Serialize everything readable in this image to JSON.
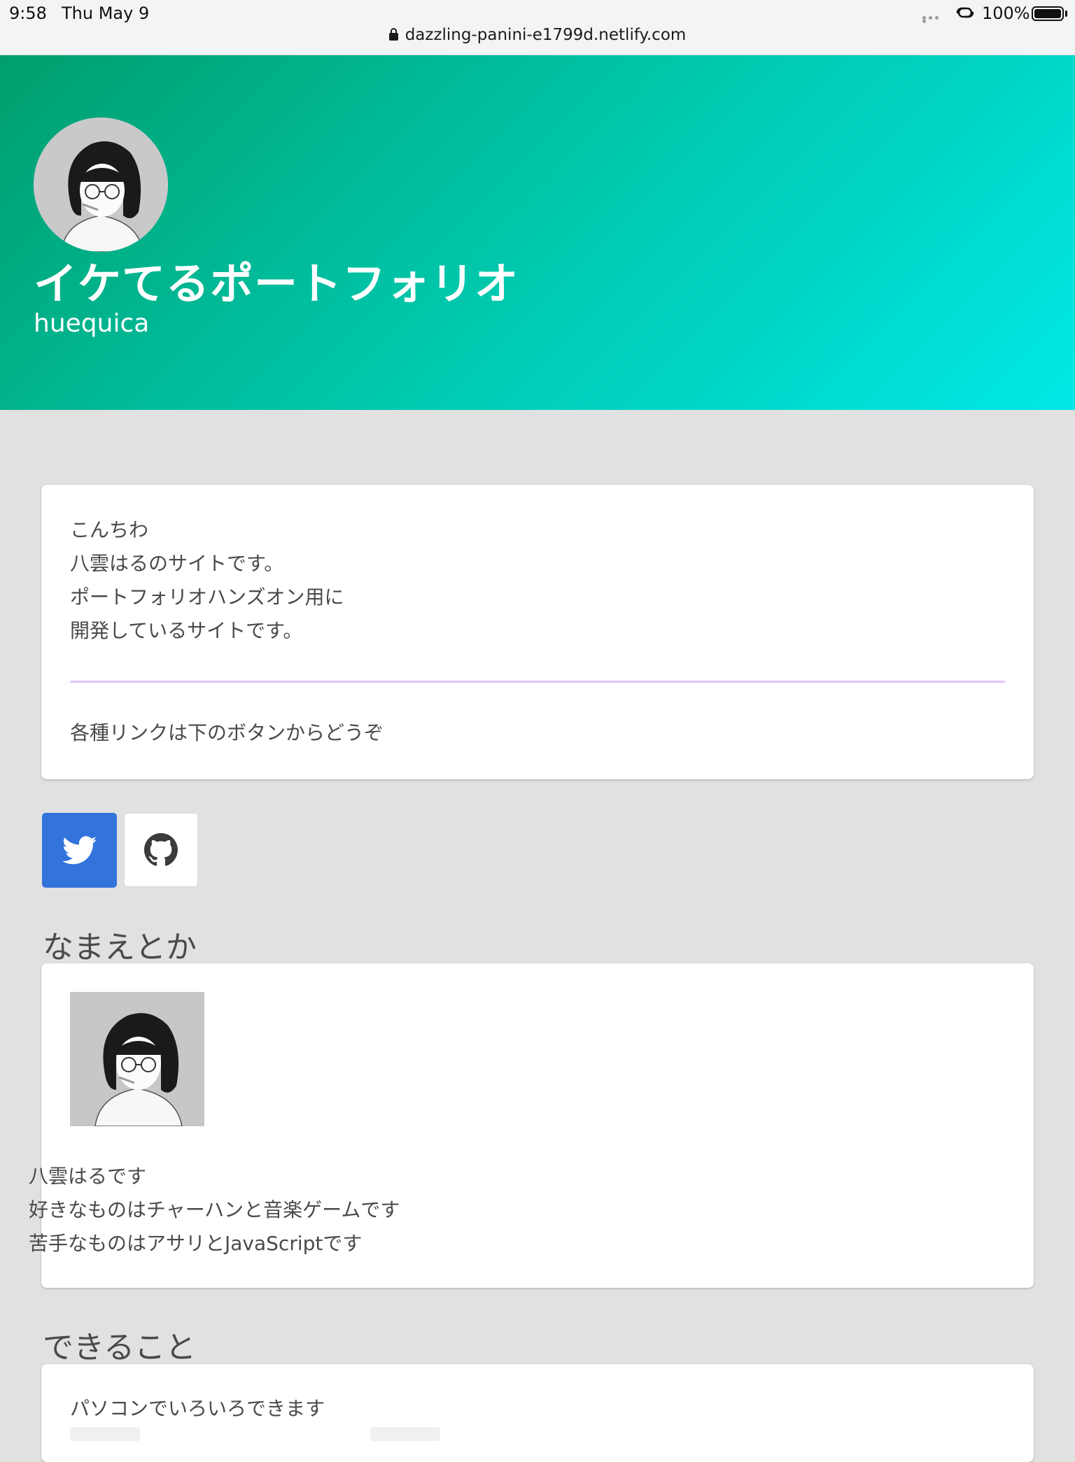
{
  "status_bar": {
    "time": "9:58",
    "date": "Thu May 9",
    "battery": "100%",
    "url": "dazzling-panini-e1799d.netlify.com"
  },
  "hero": {
    "title": "イケてるポートフォリオ",
    "subtitle": "huequica",
    "gradient": [
      "#009e6c",
      "#00e8e6"
    ]
  },
  "intro": {
    "lines": [
      "こんちわ",
      "八雲はるのサイトです。",
      "ポートフォリオハンズオン用に",
      "開発しているサイトです。"
    ],
    "note": "各種リンクは下のボタンからどうぞ",
    "divider_color": "#e4c6ff"
  },
  "buttons": {
    "twitter_icon": "twitter-bird-icon",
    "github_icon": "github-octocat-icon",
    "twitter_color": "#3273dc"
  },
  "name_section": {
    "title": "なまえとか",
    "lines": [
      "八雲はるです",
      "好きなものはチャーハンと音楽ゲームです",
      "苦手なものはアサリとJavaScriptです"
    ]
  },
  "skills_section": {
    "title": "できること",
    "lines": [
      "パソコンでいろいろできます"
    ]
  }
}
